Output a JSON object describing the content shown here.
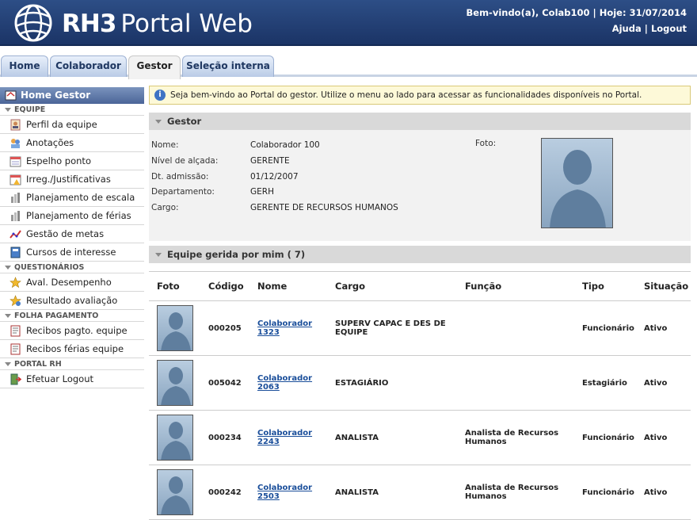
{
  "header": {
    "brand_rh3": "RH3",
    "brand_portal": "Portal Web",
    "welcome": "Bem-vindo(a), Colab100 | Hoje: 31/07/2014",
    "help": "Ajuda",
    "logout": "Logout",
    "separator": "|"
  },
  "tabs": [
    {
      "label": "Home"
    },
    {
      "label": "Colaborador"
    },
    {
      "label": "Gestor",
      "active": true
    },
    {
      "label": "Seleção interna"
    }
  ],
  "sidebar": {
    "title": "Home Gestor",
    "sections": [
      {
        "title": "EQUIPE",
        "items": [
          {
            "label": "Perfil da equipe",
            "icon": "user-card-icon"
          },
          {
            "label": "Anotações",
            "icon": "users-note-icon"
          },
          {
            "label": "Espelho ponto",
            "icon": "calendar-icon"
          },
          {
            "label": "Irreg./Justificativas",
            "icon": "calendar-alert-icon"
          },
          {
            "label": "Planejamento de escala",
            "icon": "bars-icon"
          },
          {
            "label": "Planejamento de férias",
            "icon": "bars-icon"
          },
          {
            "label": "Gestão de metas",
            "icon": "line-chart-icon"
          },
          {
            "label": "Cursos de interesse",
            "icon": "book-icon"
          }
        ]
      },
      {
        "title": "QUESTIONÁRIOS",
        "items": [
          {
            "label": "Aval. Desempenho",
            "icon": "star-user-icon"
          },
          {
            "label": "Resultado avaliação",
            "icon": "star-user-icon"
          }
        ]
      },
      {
        "title": "FOLHA PAGAMENTO",
        "items": [
          {
            "label": "Recibos pagto. equipe",
            "icon": "receipt-icon"
          },
          {
            "label": "Recibos férias equipe",
            "icon": "receipt-icon"
          }
        ]
      },
      {
        "title": "PORTAL RH",
        "items": [
          {
            "label": "Efetuar Logout",
            "icon": "logout-icon"
          }
        ]
      }
    ]
  },
  "notice": "Seja bem-vindo ao Portal do gestor. Utilize o menu ao lado para acessar as funcionalidades disponíveis no Portal.",
  "gestor": {
    "title": "Gestor",
    "foto_label": "Foto:",
    "fields": [
      {
        "label": "Nome:",
        "value": "Colaborador 100"
      },
      {
        "label": "Nível de alçada:",
        "value": "GERENTE"
      },
      {
        "label": "Dt. admissão:",
        "value": "01/12/2007"
      },
      {
        "label": "Departamento:",
        "value": "GERH"
      },
      {
        "label": "Cargo:",
        "value": "GERENTE DE RECURSOS HUMANOS"
      }
    ]
  },
  "equipe": {
    "title": "Equipe gerida por mim ( 7)",
    "columns": [
      "Foto",
      "Código",
      "Nome",
      "Cargo",
      "Função",
      "Tipo",
      "Situação"
    ],
    "rows": [
      {
        "codigo": "000205",
        "nome1": "Colaborador",
        "nome2": "1323",
        "cargo1": "SUPERV CAPAC E DES DE",
        "cargo2": "EQUIPE",
        "funcao1": "",
        "funcao2": "",
        "tipo": "Funcionário",
        "situacao": "Ativo"
      },
      {
        "codigo": "005042",
        "nome1": "Colaborador",
        "nome2": "2063",
        "cargo1": "ESTAGIÁRIO",
        "cargo2": "",
        "funcao1": "",
        "funcao2": "",
        "tipo": "Estagiário",
        "situacao": "Ativo"
      },
      {
        "codigo": "000234",
        "nome1": "Colaborador",
        "nome2": "2243",
        "cargo1": "ANALISTA",
        "cargo2": "",
        "funcao1": "Analista de Recursos",
        "funcao2": "Humanos",
        "tipo": "Funcionário",
        "situacao": "Ativo"
      },
      {
        "codigo": "000242",
        "nome1": "Colaborador",
        "nome2": "2503",
        "cargo1": "ANALISTA",
        "cargo2": "",
        "funcao1": "Analista de Recursos",
        "funcao2": "Humanos",
        "tipo": "Funcionário",
        "situacao": "Ativo"
      }
    ]
  }
}
